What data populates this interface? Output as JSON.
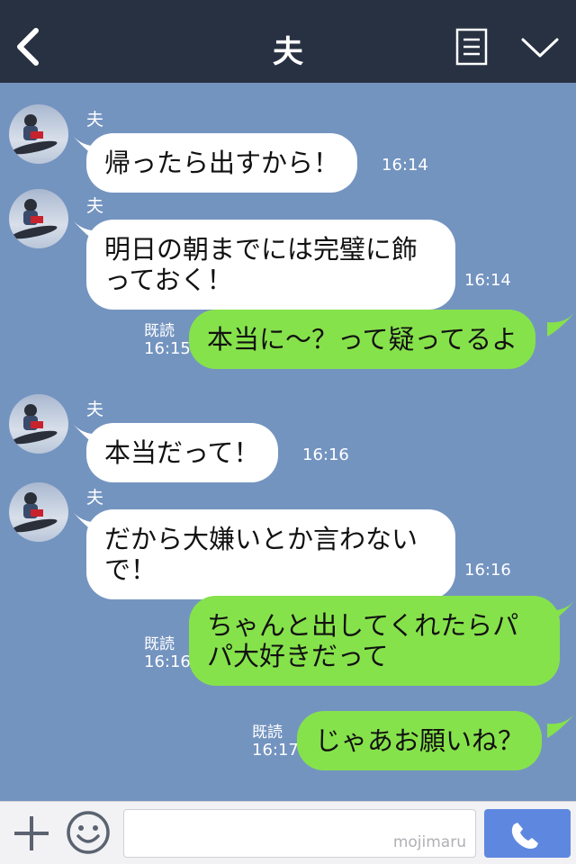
{
  "header": {
    "title": "夫",
    "back_icon": "chevron-left-icon",
    "memo_icon": "memo-icon",
    "menu_icon": "chevron-down-icon"
  },
  "messages": [
    {
      "sender": "夫",
      "text": "帰ったら出すから！",
      "time": "16:14"
    },
    {
      "sender": "夫",
      "text": "明日の朝までには完璧に飾\nっておく！",
      "time": "16:14"
    },
    {
      "text": "本当に〜？って疑ってるよ",
      "read": "既読",
      "time": "16:15"
    },
    {
      "sender": "夫",
      "text": "本当だって！",
      "time": "16:16"
    },
    {
      "sender": "夫",
      "text": "だから大嫌いとか言わない\nで！",
      "time": "16:16"
    },
    {
      "text": "ちゃんと出してくれたらパ\nパ大好きだって",
      "read": "既読",
      "time": "16:16"
    },
    {
      "text": "じゃあお願いね？",
      "read": "既読",
      "time": "16:17"
    }
  ],
  "footer": {
    "watermark": "mojimaru",
    "plus_icon": "plus-icon",
    "sticker_icon": "smiley-icon",
    "call_icon": "phone-icon"
  },
  "colors": {
    "header_bg": "#283142",
    "chat_bg": "#7494c0",
    "incoming_bubble": "#ffffff",
    "outgoing_bubble": "#86e24b",
    "call_button": "#5e87e0"
  }
}
